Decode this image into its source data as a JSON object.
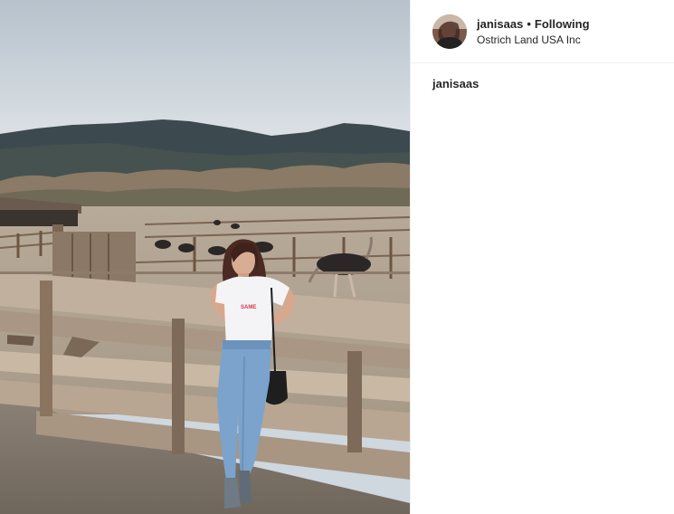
{
  "header": {
    "username": "janisaas",
    "separator": "•",
    "follow_status": "Following",
    "location": "Ostrich Land USA Inc"
  },
  "caption": {
    "username": "janisaas"
  },
  "photo": {
    "shirt_text": "SAME"
  },
  "colors": {
    "text": "#262626",
    "divider": "#efefef",
    "background": "#ffffff"
  }
}
